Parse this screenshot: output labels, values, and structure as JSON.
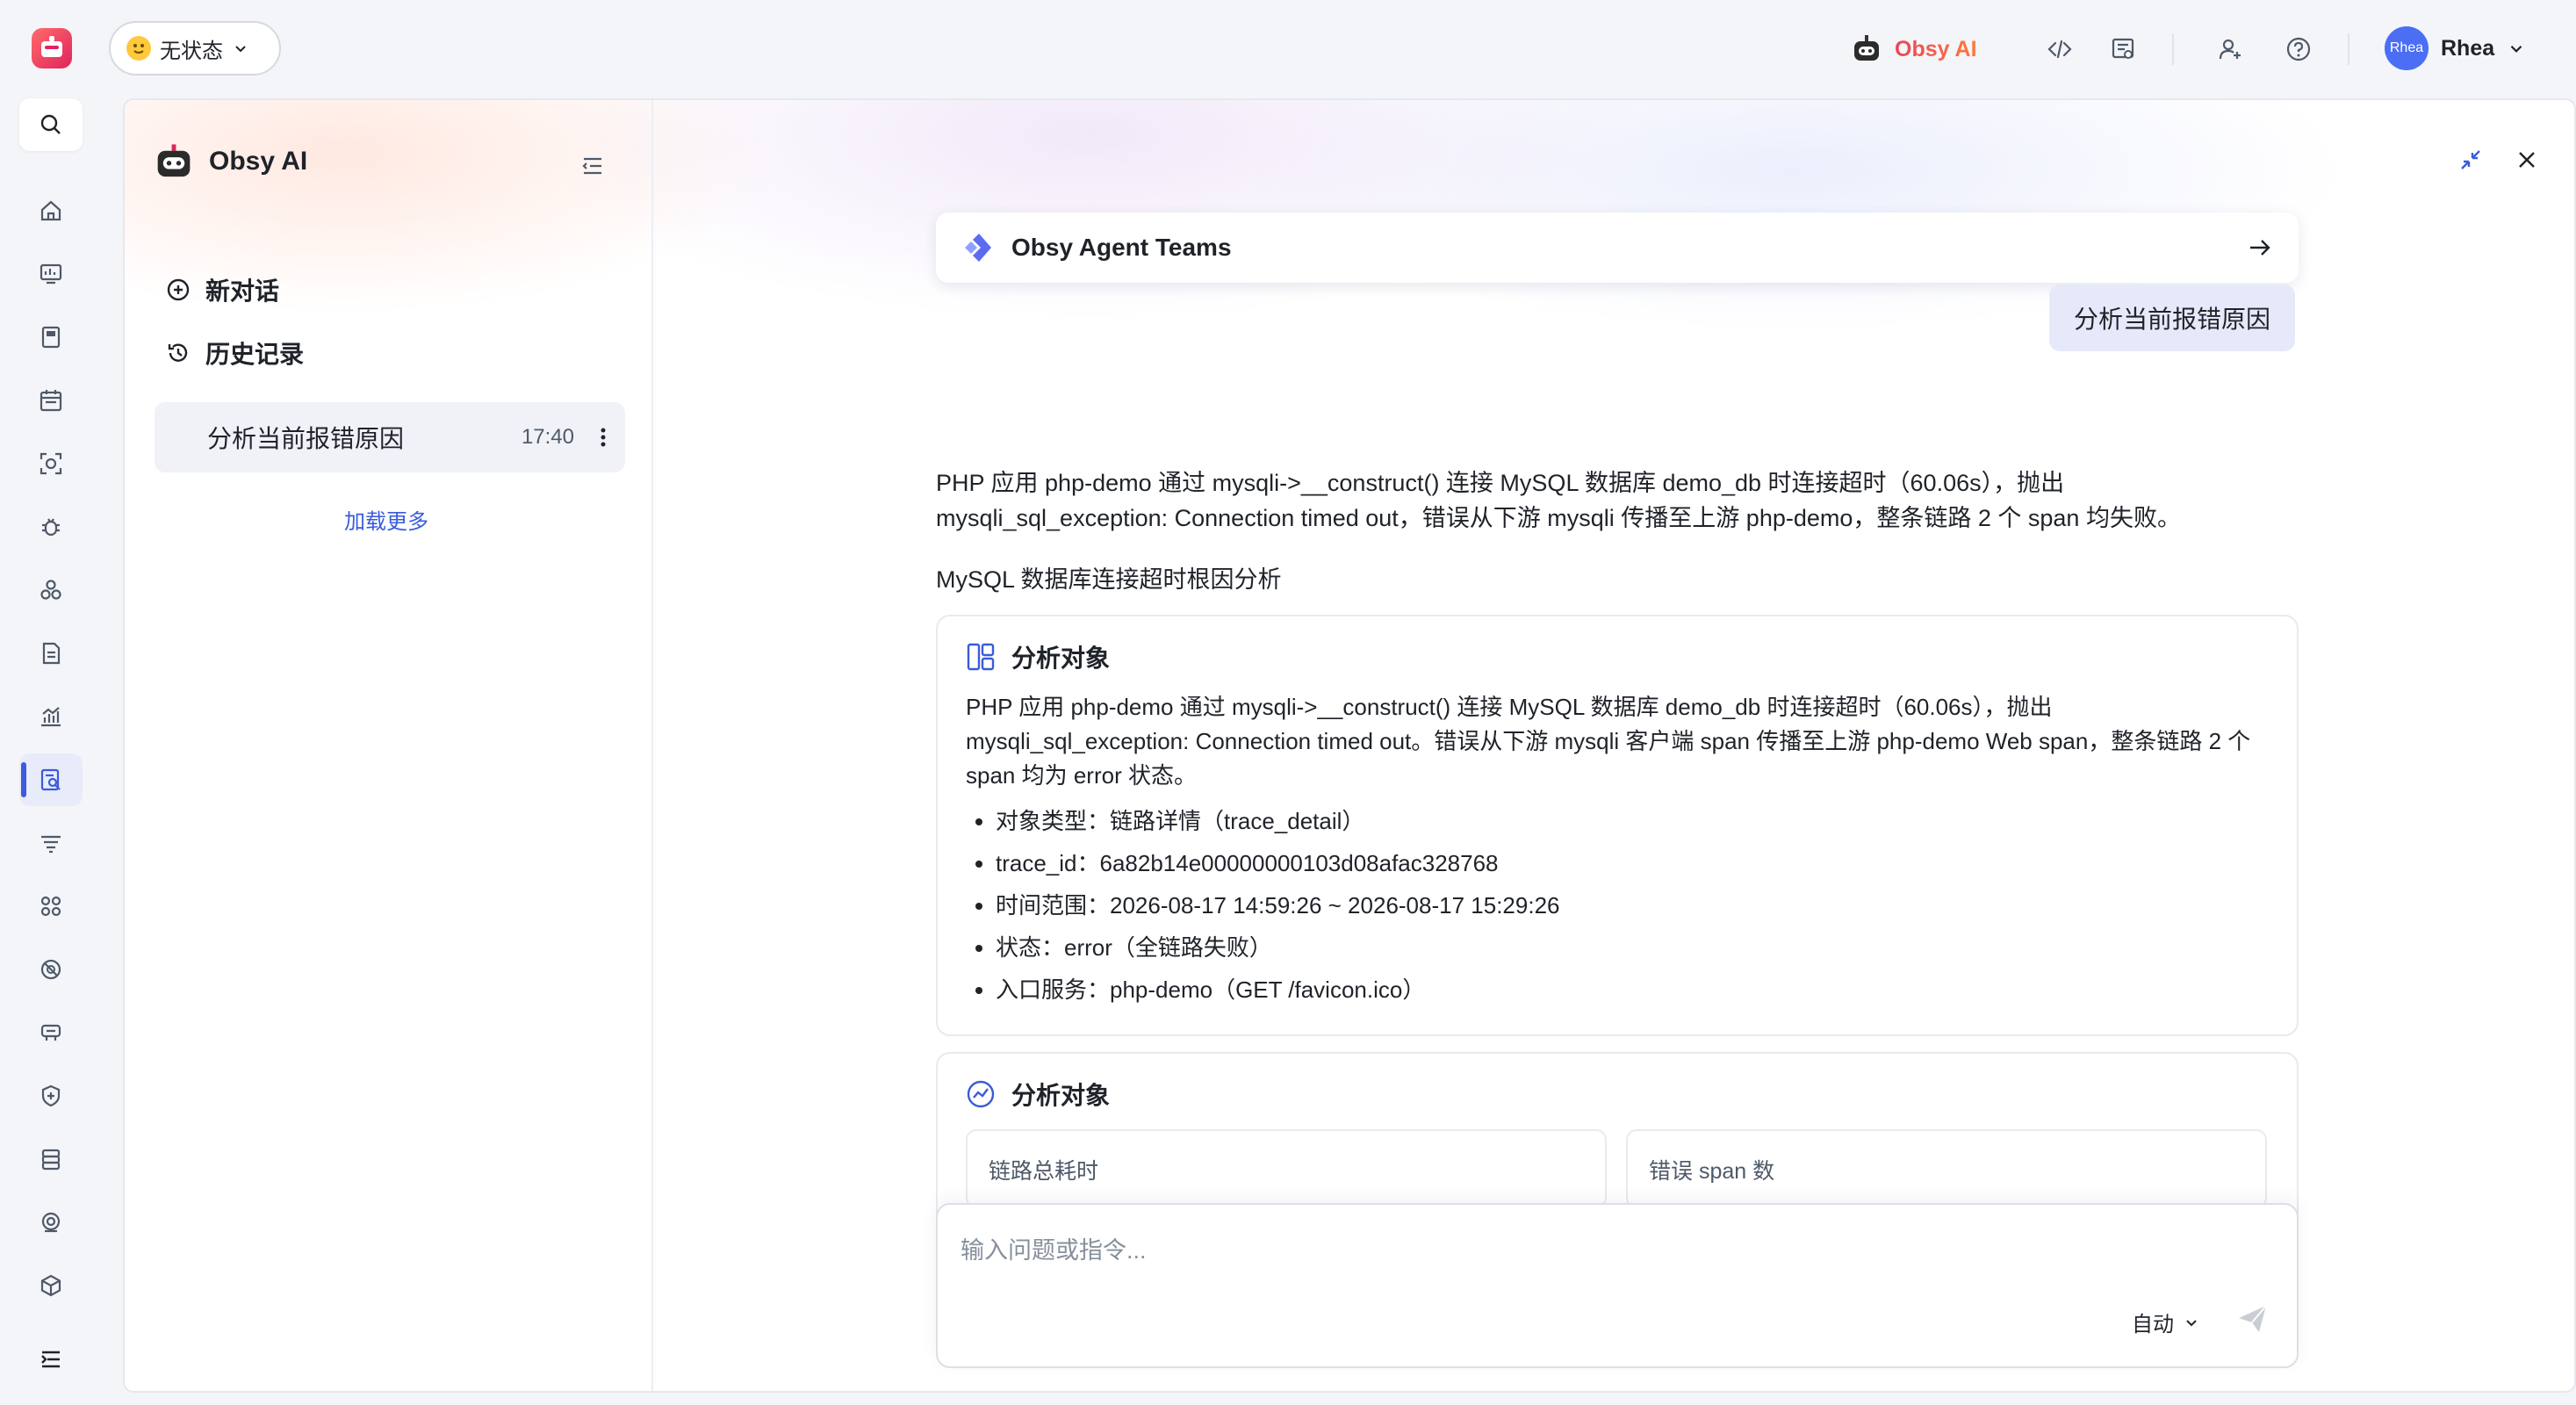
{
  "topbar": {
    "status_label": "无状态",
    "brand_label": "Obsy AI",
    "user_avatar_text": "Rhea",
    "user_name": "Rhea"
  },
  "leftnav": {
    "items": [
      "search-icon",
      "home-icon",
      "dashboard-icon",
      "notebook-icon",
      "calendar-icon",
      "scan-icon",
      "bug-icon",
      "cluster-icon",
      "log-icon",
      "metrics-icon",
      "trace-analysis-icon",
      "filter-icon",
      "apps-icon",
      "ban-icon",
      "network-icon",
      "security-icon",
      "database-icon",
      "monitor-icon",
      "cube-icon",
      "expand-menu-icon"
    ],
    "active_index": 10
  },
  "sidebar": {
    "title": "Obsy AI",
    "new_chat": "新对话",
    "history": "历史记录",
    "history_items": [
      {
        "title": "分析当前报错原因",
        "time": "17:40"
      }
    ],
    "load_more": "加载更多"
  },
  "chat": {
    "agent_card_title": "Obsy Agent Teams",
    "user_message": "分析当前报错原因",
    "answer_line1": "PHP 应用 php-demo 通过 mysqli->__construct() 连接 MySQL 数据库 demo_db 时连接超时（60.06s），抛出",
    "answer_line2": "mysqli_sql_exception: Connection timed out，错误从下游 mysqli 传播至上游 php-demo，整条链路 2 个 span 均失败。",
    "section_title": "MySQL 数据库连接超时根因分析",
    "card1": {
      "title": "分析对象",
      "description": "PHP 应用 php-demo 通过 mysqli->__construct() 连接 MySQL 数据库 demo_db 时连接超时（60.06s），抛出 mysqli_sql_exception: Connection timed out。错误从下游 mysqli 客户端 span 传播至上游 php-demo Web span，整条链路 2 个 span 均为 error 状态。",
      "bullets": [
        "对象类型：链路详情（trace_detail）",
        "trace_id：6a82b14e00000000103d08afac328768",
        "时间范围：2026-08-17 14:59:26 ~ 2026-08-17 15:29:26",
        "状态：error（全链路失败）",
        "入口服务：php-demo（GET /favicon.ico）"
      ]
    },
    "card2": {
      "title": "分析对象",
      "metrics": [
        "链路总耗时",
        "错误 span 数"
      ]
    },
    "input_placeholder": "输入问题或指令...",
    "mode_label": "自动"
  }
}
